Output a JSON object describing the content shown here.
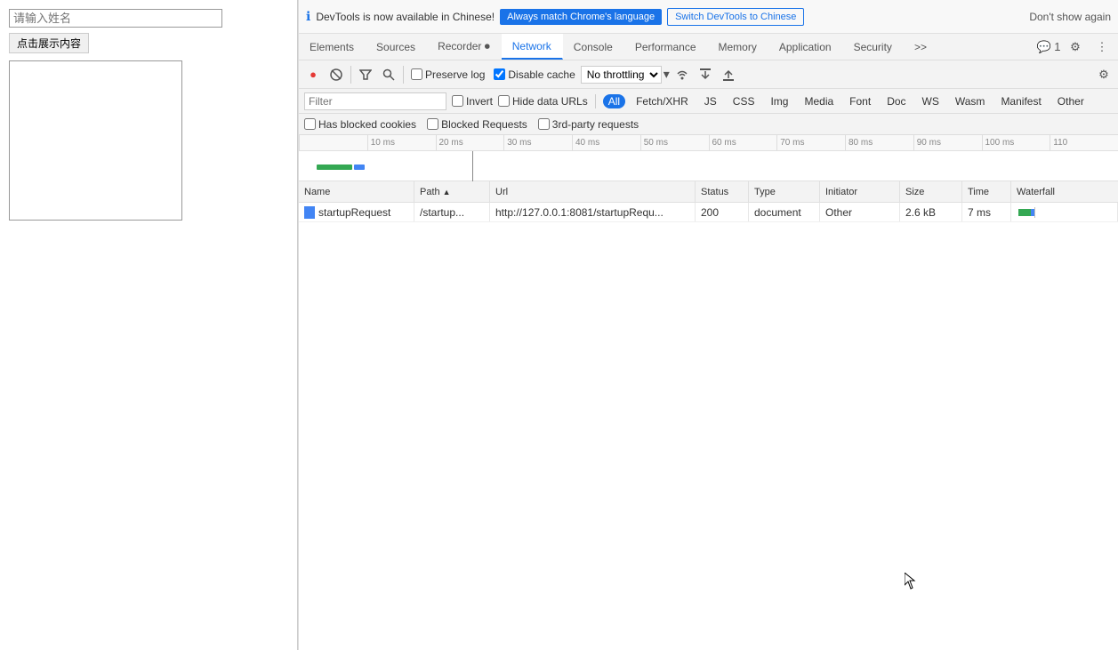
{
  "page": {
    "input_placeholder": "请输入姓名",
    "button_label": "点击展示内容"
  },
  "notification": {
    "text": "DevTools is now available in Chinese!",
    "btn_match": "Always match Chrome's language",
    "btn_switch": "Switch DevTools to Chinese",
    "btn_dismiss": "Don't show again",
    "info_icon": "ℹ"
  },
  "tabs": [
    {
      "id": "elements",
      "label": "Elements"
    },
    {
      "id": "sources",
      "label": "Sources"
    },
    {
      "id": "recorder",
      "label": "Recorder ⏺"
    },
    {
      "id": "network",
      "label": "Network",
      "active": true
    },
    {
      "id": "console",
      "label": "Console"
    },
    {
      "id": "performance",
      "label": "Performance"
    },
    {
      "id": "memory",
      "label": "Memory"
    },
    {
      "id": "application",
      "label": "Application"
    },
    {
      "id": "security",
      "label": "Security"
    },
    {
      "id": "more",
      "label": ">>"
    }
  ],
  "tab_icons": {
    "chat_badge": "💬 1",
    "settings": "⚙",
    "more": "⋮"
  },
  "toolbar": {
    "record_icon": "●",
    "clear_icon": "🚫",
    "filter_icon": "⬦",
    "search_icon": "🔍",
    "preserve_log_label": "Preserve log",
    "disable_cache_label": "Disable cache",
    "throttling_label": "No throttling",
    "wifi_icon": "📶",
    "import_icon": "⬆",
    "export_icon": "⬇",
    "settings_icon": "⚙"
  },
  "filter_bar": {
    "placeholder": "Filter",
    "invert_label": "Invert",
    "hide_data_urls_label": "Hide data URLs",
    "types": [
      "All",
      "Fetch/XHR",
      "JS",
      "CSS",
      "Img",
      "Media",
      "Font",
      "Doc",
      "WS",
      "Wasm",
      "Manifest",
      "Other"
    ],
    "active_type": "All"
  },
  "filter_bar2": {
    "has_blocked_cookies": "Has blocked cookies",
    "blocked_requests": "Blocked Requests",
    "third_party": "3rd-party requests"
  },
  "timeline": {
    "marks": [
      "10 ms",
      "20 ms",
      "30 ms",
      "40 ms",
      "50 ms",
      "60 ms",
      "70 ms",
      "80 ms",
      "90 ms",
      "100 ms",
      "110"
    ]
  },
  "table": {
    "headers": [
      {
        "id": "name",
        "label": "Name"
      },
      {
        "id": "path",
        "label": "Path",
        "sort_asc": true
      },
      {
        "id": "url",
        "label": "Url"
      },
      {
        "id": "status",
        "label": "Status"
      },
      {
        "id": "type",
        "label": "Type"
      },
      {
        "id": "initiator",
        "label": "Initiator"
      },
      {
        "id": "size",
        "label": "Size"
      },
      {
        "id": "time",
        "label": "Time"
      },
      {
        "id": "waterfall",
        "label": "Waterfall"
      }
    ],
    "rows": [
      {
        "name": "startupRequest",
        "path": "/startup...",
        "url": "http://127.0.0.1:8081/startupRequ...",
        "status": "200",
        "type": "document",
        "initiator": "Other",
        "size": "2.6 kB",
        "time": "7 ms"
      }
    ]
  }
}
